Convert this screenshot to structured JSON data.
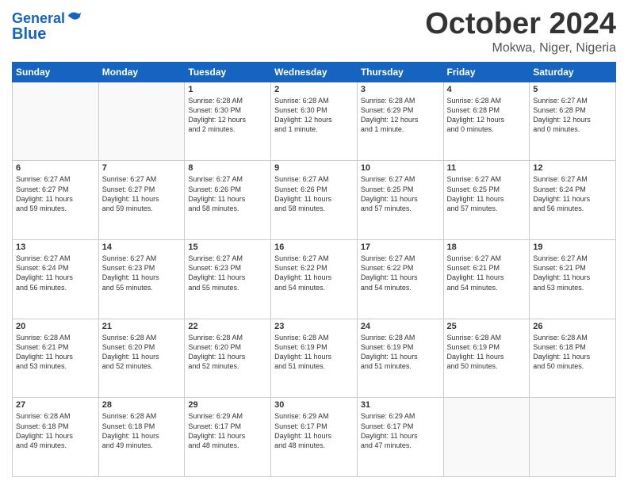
{
  "header": {
    "logo_line1": "General",
    "logo_line2": "Blue",
    "month": "October 2024",
    "location": "Mokwa, Niger, Nigeria"
  },
  "weekdays": [
    "Sunday",
    "Monday",
    "Tuesday",
    "Wednesday",
    "Thursday",
    "Friday",
    "Saturday"
  ],
  "weeks": [
    [
      {
        "day": "",
        "content": ""
      },
      {
        "day": "",
        "content": ""
      },
      {
        "day": "1",
        "content": "Sunrise: 6:28 AM\nSunset: 6:30 PM\nDaylight: 12 hours\nand 2 minutes."
      },
      {
        "day": "2",
        "content": "Sunrise: 6:28 AM\nSunset: 6:30 PM\nDaylight: 12 hours\nand 1 minute."
      },
      {
        "day": "3",
        "content": "Sunrise: 6:28 AM\nSunset: 6:29 PM\nDaylight: 12 hours\nand 1 minute."
      },
      {
        "day": "4",
        "content": "Sunrise: 6:28 AM\nSunset: 6:28 PM\nDaylight: 12 hours\nand 0 minutes."
      },
      {
        "day": "5",
        "content": "Sunrise: 6:27 AM\nSunset: 6:28 PM\nDaylight: 12 hours\nand 0 minutes."
      }
    ],
    [
      {
        "day": "6",
        "content": "Sunrise: 6:27 AM\nSunset: 6:27 PM\nDaylight: 11 hours\nand 59 minutes."
      },
      {
        "day": "7",
        "content": "Sunrise: 6:27 AM\nSunset: 6:27 PM\nDaylight: 11 hours\nand 59 minutes."
      },
      {
        "day": "8",
        "content": "Sunrise: 6:27 AM\nSunset: 6:26 PM\nDaylight: 11 hours\nand 58 minutes."
      },
      {
        "day": "9",
        "content": "Sunrise: 6:27 AM\nSunset: 6:26 PM\nDaylight: 11 hours\nand 58 minutes."
      },
      {
        "day": "10",
        "content": "Sunrise: 6:27 AM\nSunset: 6:25 PM\nDaylight: 11 hours\nand 57 minutes."
      },
      {
        "day": "11",
        "content": "Sunrise: 6:27 AM\nSunset: 6:25 PM\nDaylight: 11 hours\nand 57 minutes."
      },
      {
        "day": "12",
        "content": "Sunrise: 6:27 AM\nSunset: 6:24 PM\nDaylight: 11 hours\nand 56 minutes."
      }
    ],
    [
      {
        "day": "13",
        "content": "Sunrise: 6:27 AM\nSunset: 6:24 PM\nDaylight: 11 hours\nand 56 minutes."
      },
      {
        "day": "14",
        "content": "Sunrise: 6:27 AM\nSunset: 6:23 PM\nDaylight: 11 hours\nand 55 minutes."
      },
      {
        "day": "15",
        "content": "Sunrise: 6:27 AM\nSunset: 6:23 PM\nDaylight: 11 hours\nand 55 minutes."
      },
      {
        "day": "16",
        "content": "Sunrise: 6:27 AM\nSunset: 6:22 PM\nDaylight: 11 hours\nand 54 minutes."
      },
      {
        "day": "17",
        "content": "Sunrise: 6:27 AM\nSunset: 6:22 PM\nDaylight: 11 hours\nand 54 minutes."
      },
      {
        "day": "18",
        "content": "Sunrise: 6:27 AM\nSunset: 6:21 PM\nDaylight: 11 hours\nand 54 minutes."
      },
      {
        "day": "19",
        "content": "Sunrise: 6:27 AM\nSunset: 6:21 PM\nDaylight: 11 hours\nand 53 minutes."
      }
    ],
    [
      {
        "day": "20",
        "content": "Sunrise: 6:28 AM\nSunset: 6:21 PM\nDaylight: 11 hours\nand 53 minutes."
      },
      {
        "day": "21",
        "content": "Sunrise: 6:28 AM\nSunset: 6:20 PM\nDaylight: 11 hours\nand 52 minutes."
      },
      {
        "day": "22",
        "content": "Sunrise: 6:28 AM\nSunset: 6:20 PM\nDaylight: 11 hours\nand 52 minutes."
      },
      {
        "day": "23",
        "content": "Sunrise: 6:28 AM\nSunset: 6:19 PM\nDaylight: 11 hours\nand 51 minutes."
      },
      {
        "day": "24",
        "content": "Sunrise: 6:28 AM\nSunset: 6:19 PM\nDaylight: 11 hours\nand 51 minutes."
      },
      {
        "day": "25",
        "content": "Sunrise: 6:28 AM\nSunset: 6:19 PM\nDaylight: 11 hours\nand 50 minutes."
      },
      {
        "day": "26",
        "content": "Sunrise: 6:28 AM\nSunset: 6:18 PM\nDaylight: 11 hours\nand 50 minutes."
      }
    ],
    [
      {
        "day": "27",
        "content": "Sunrise: 6:28 AM\nSunset: 6:18 PM\nDaylight: 11 hours\nand 49 minutes."
      },
      {
        "day": "28",
        "content": "Sunrise: 6:28 AM\nSunset: 6:18 PM\nDaylight: 11 hours\nand 49 minutes."
      },
      {
        "day": "29",
        "content": "Sunrise: 6:29 AM\nSunset: 6:17 PM\nDaylight: 11 hours\nand 48 minutes."
      },
      {
        "day": "30",
        "content": "Sunrise: 6:29 AM\nSunset: 6:17 PM\nDaylight: 11 hours\nand 48 minutes."
      },
      {
        "day": "31",
        "content": "Sunrise: 6:29 AM\nSunset: 6:17 PM\nDaylight: 11 hours\nand 47 minutes."
      },
      {
        "day": "",
        "content": ""
      },
      {
        "day": "",
        "content": ""
      }
    ]
  ]
}
